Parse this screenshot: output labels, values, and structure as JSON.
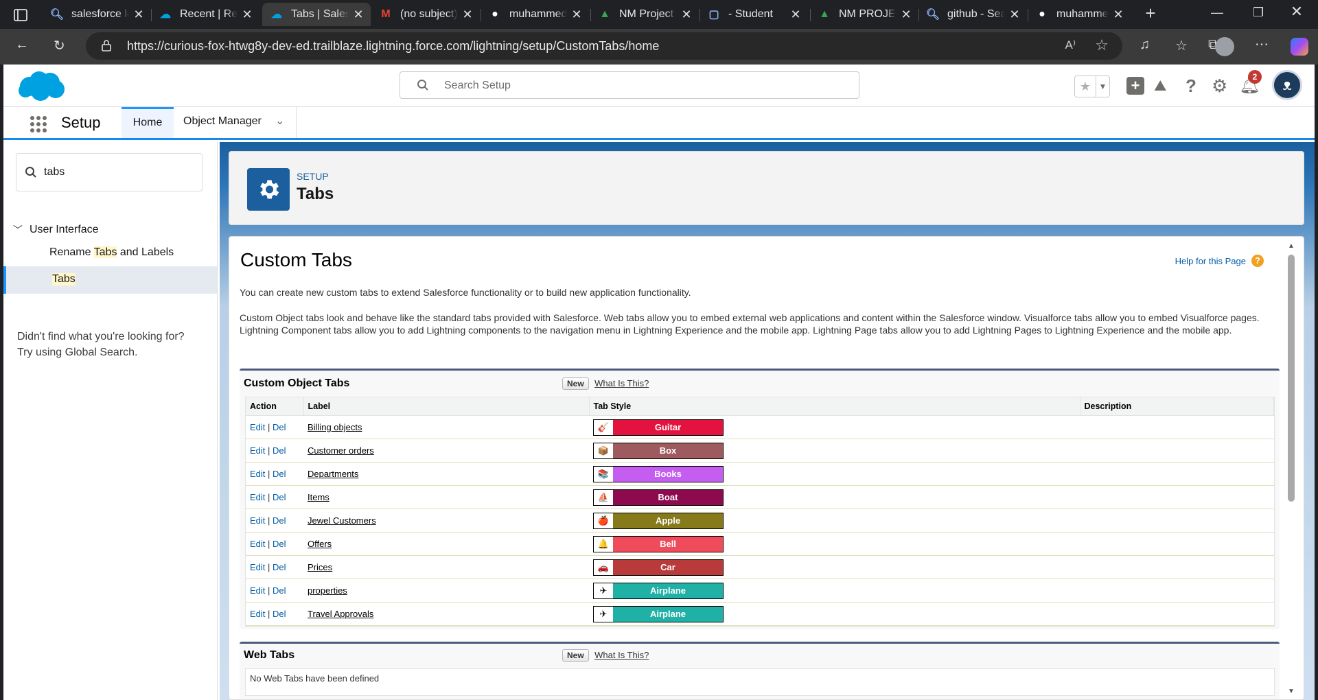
{
  "browser": {
    "tabs": [
      {
        "title": "salesforce lo",
        "icon": "search-icon"
      },
      {
        "title": "Recent | Rep",
        "icon": "salesforce-icon"
      },
      {
        "title": "Tabs | Salesfo",
        "icon": "salesforce-icon"
      },
      {
        "title": "(no subject)",
        "icon": "gmail-icon"
      },
      {
        "title": "muhammed",
        "icon": "github-icon"
      },
      {
        "title": "NM Project V",
        "icon": "drive-icon"
      },
      {
        "title": "- Student",
        "icon": "page-icon"
      },
      {
        "title": "NM PROJEC",
        "icon": "drive-icon"
      },
      {
        "title": "github - Sea",
        "icon": "search-icon"
      },
      {
        "title": "muhammed",
        "icon": "github-icon"
      }
    ],
    "url": "https://curious-fox-htwg8y-dev-ed.trailblaze.lightning.force.com/lightning/setup/CustomTabs/home"
  },
  "header": {
    "search_placeholder": "Search Setup",
    "notification_count": "2"
  },
  "nav": {
    "app_name": "Setup",
    "home": "Home",
    "object_manager": "Object Manager"
  },
  "sidebar": {
    "search_value": "tabs",
    "section": "User Interface",
    "items": [
      {
        "pre": "Rename ",
        "hl": "Tabs",
        "post": " and Labels"
      },
      {
        "pre": "",
        "hl": "Tabs",
        "post": ""
      }
    ],
    "help_line1": "Didn't find what you're looking for?",
    "help_line2": "Try using Global Search."
  },
  "page_header": {
    "eyebrow": "SETUP",
    "title": "Tabs"
  },
  "content": {
    "title": "Custom Tabs",
    "help_link": "Help for this Page",
    "intro": "You can create new custom tabs to extend Salesforce functionality or to build new application functionality.",
    "description": "Custom Object tabs look and behave like the standard tabs provided with Salesforce. Web tabs allow you to embed external web applications and content within the Salesforce window. Visualforce tabs allow you to embed Visualforce pages. Lightning Component tabs allow you to add Lightning components to the navigation menu in Lightning Experience and the mobile app. Lightning Page tabs allow you to add Lightning Pages to Lightning Experience and the mobile app."
  },
  "custom_object_tabs": {
    "title": "Custom Object Tabs",
    "new_button": "New",
    "what_is_this": "What Is This?",
    "columns": [
      "Action",
      "Label",
      "Tab Style",
      "Description"
    ],
    "edit": "Edit",
    "sep": " | ",
    "del": "Del",
    "rows": [
      {
        "label": "Billing objects",
        "style": "Guitar",
        "color": "#e3123f",
        "icon": "🎸"
      },
      {
        "label": "Customer orders",
        "style": "Box",
        "color": "#9e5a5e",
        "icon": "📦"
      },
      {
        "label": "Departments",
        "style": "Books",
        "color": "#c55ef0",
        "icon": "📚"
      },
      {
        "label": "Items",
        "style": "Boat",
        "color": "#8e0a4f",
        "icon": "⛵"
      },
      {
        "label": "Jewel Customers",
        "style": "Apple",
        "color": "#867a1a",
        "icon": "🍎"
      },
      {
        "label": "Offers",
        "style": "Bell",
        "color": "#f04b5a",
        "icon": "🔔"
      },
      {
        "label": "Prices",
        "style": "Car",
        "color": "#b83a3a",
        "icon": "🚗"
      },
      {
        "label": "properties",
        "style": "Airplane",
        "color": "#1fb0a6",
        "icon": "✈"
      },
      {
        "label": "Travel Approvals",
        "style": "Airplane",
        "color": "#1fb0a6",
        "icon": "✈"
      }
    ]
  },
  "web_tabs": {
    "title": "Web Tabs",
    "new_button": "New",
    "what_is_this": "What Is This?",
    "empty": "No Web Tabs have been defined"
  }
}
